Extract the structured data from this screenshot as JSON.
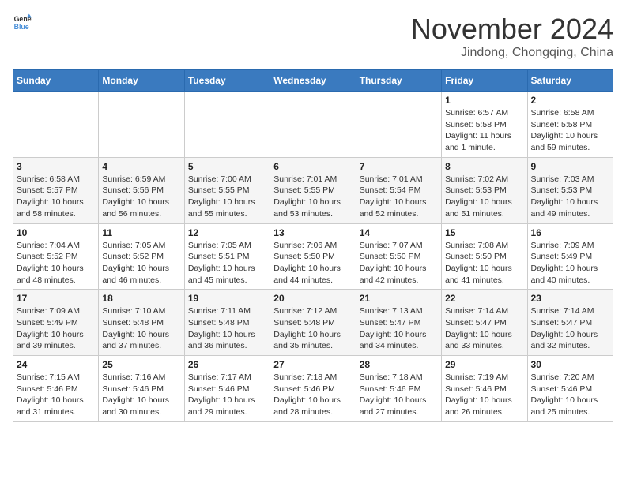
{
  "header": {
    "logo_general": "General",
    "logo_blue": "Blue",
    "month": "November 2024",
    "location": "Jindong, Chongqing, China"
  },
  "days_of_week": [
    "Sunday",
    "Monday",
    "Tuesday",
    "Wednesday",
    "Thursday",
    "Friday",
    "Saturday"
  ],
  "weeks": [
    [
      {
        "day": "",
        "info": ""
      },
      {
        "day": "",
        "info": ""
      },
      {
        "day": "",
        "info": ""
      },
      {
        "day": "",
        "info": ""
      },
      {
        "day": "",
        "info": ""
      },
      {
        "day": "1",
        "info": "Sunrise: 6:57 AM\nSunset: 5:58 PM\nDaylight: 11 hours and 1 minute."
      },
      {
        "day": "2",
        "info": "Sunrise: 6:58 AM\nSunset: 5:58 PM\nDaylight: 10 hours and 59 minutes."
      }
    ],
    [
      {
        "day": "3",
        "info": "Sunrise: 6:58 AM\nSunset: 5:57 PM\nDaylight: 10 hours and 58 minutes."
      },
      {
        "day": "4",
        "info": "Sunrise: 6:59 AM\nSunset: 5:56 PM\nDaylight: 10 hours and 56 minutes."
      },
      {
        "day": "5",
        "info": "Sunrise: 7:00 AM\nSunset: 5:55 PM\nDaylight: 10 hours and 55 minutes."
      },
      {
        "day": "6",
        "info": "Sunrise: 7:01 AM\nSunset: 5:55 PM\nDaylight: 10 hours and 53 minutes."
      },
      {
        "day": "7",
        "info": "Sunrise: 7:01 AM\nSunset: 5:54 PM\nDaylight: 10 hours and 52 minutes."
      },
      {
        "day": "8",
        "info": "Sunrise: 7:02 AM\nSunset: 5:53 PM\nDaylight: 10 hours and 51 minutes."
      },
      {
        "day": "9",
        "info": "Sunrise: 7:03 AM\nSunset: 5:53 PM\nDaylight: 10 hours and 49 minutes."
      }
    ],
    [
      {
        "day": "10",
        "info": "Sunrise: 7:04 AM\nSunset: 5:52 PM\nDaylight: 10 hours and 48 minutes."
      },
      {
        "day": "11",
        "info": "Sunrise: 7:05 AM\nSunset: 5:52 PM\nDaylight: 10 hours and 46 minutes."
      },
      {
        "day": "12",
        "info": "Sunrise: 7:05 AM\nSunset: 5:51 PM\nDaylight: 10 hours and 45 minutes."
      },
      {
        "day": "13",
        "info": "Sunrise: 7:06 AM\nSunset: 5:50 PM\nDaylight: 10 hours and 44 minutes."
      },
      {
        "day": "14",
        "info": "Sunrise: 7:07 AM\nSunset: 5:50 PM\nDaylight: 10 hours and 42 minutes."
      },
      {
        "day": "15",
        "info": "Sunrise: 7:08 AM\nSunset: 5:50 PM\nDaylight: 10 hours and 41 minutes."
      },
      {
        "day": "16",
        "info": "Sunrise: 7:09 AM\nSunset: 5:49 PM\nDaylight: 10 hours and 40 minutes."
      }
    ],
    [
      {
        "day": "17",
        "info": "Sunrise: 7:09 AM\nSunset: 5:49 PM\nDaylight: 10 hours and 39 minutes."
      },
      {
        "day": "18",
        "info": "Sunrise: 7:10 AM\nSunset: 5:48 PM\nDaylight: 10 hours and 37 minutes."
      },
      {
        "day": "19",
        "info": "Sunrise: 7:11 AM\nSunset: 5:48 PM\nDaylight: 10 hours and 36 minutes."
      },
      {
        "day": "20",
        "info": "Sunrise: 7:12 AM\nSunset: 5:48 PM\nDaylight: 10 hours and 35 minutes."
      },
      {
        "day": "21",
        "info": "Sunrise: 7:13 AM\nSunset: 5:47 PM\nDaylight: 10 hours and 34 minutes."
      },
      {
        "day": "22",
        "info": "Sunrise: 7:14 AM\nSunset: 5:47 PM\nDaylight: 10 hours and 33 minutes."
      },
      {
        "day": "23",
        "info": "Sunrise: 7:14 AM\nSunset: 5:47 PM\nDaylight: 10 hours and 32 minutes."
      }
    ],
    [
      {
        "day": "24",
        "info": "Sunrise: 7:15 AM\nSunset: 5:46 PM\nDaylight: 10 hours and 31 minutes."
      },
      {
        "day": "25",
        "info": "Sunrise: 7:16 AM\nSunset: 5:46 PM\nDaylight: 10 hours and 30 minutes."
      },
      {
        "day": "26",
        "info": "Sunrise: 7:17 AM\nSunset: 5:46 PM\nDaylight: 10 hours and 29 minutes."
      },
      {
        "day": "27",
        "info": "Sunrise: 7:18 AM\nSunset: 5:46 PM\nDaylight: 10 hours and 28 minutes."
      },
      {
        "day": "28",
        "info": "Sunrise: 7:18 AM\nSunset: 5:46 PM\nDaylight: 10 hours and 27 minutes."
      },
      {
        "day": "29",
        "info": "Sunrise: 7:19 AM\nSunset: 5:46 PM\nDaylight: 10 hours and 26 minutes."
      },
      {
        "day": "30",
        "info": "Sunrise: 7:20 AM\nSunset: 5:46 PM\nDaylight: 10 hours and 25 minutes."
      }
    ]
  ]
}
